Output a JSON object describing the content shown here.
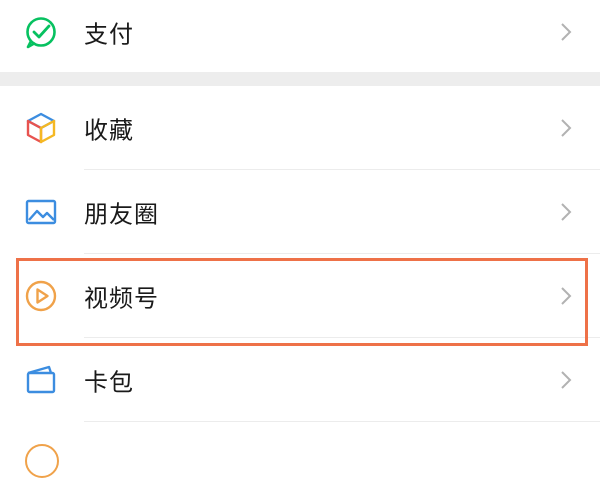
{
  "menu": {
    "items": [
      {
        "id": "pay",
        "label": "支付",
        "icon": "wechat-pay-icon"
      },
      {
        "id": "favorites",
        "label": "收藏",
        "icon": "favorites-cube-icon"
      },
      {
        "id": "moments",
        "label": "朋友圈",
        "icon": "moments-image-icon"
      },
      {
        "id": "channels",
        "label": "视频号",
        "icon": "channels-play-icon",
        "highlighted": true
      },
      {
        "id": "cards",
        "label": "卡包",
        "icon": "card-wallet-icon"
      }
    ]
  },
  "colors": {
    "pay_green": "#07c160",
    "highlight_border": "#ee7148",
    "chevron": "#b2b2b2",
    "section_gap": "#ededed",
    "channels_orange": "#f0a24a",
    "moments_blue": "#3c8de0"
  }
}
